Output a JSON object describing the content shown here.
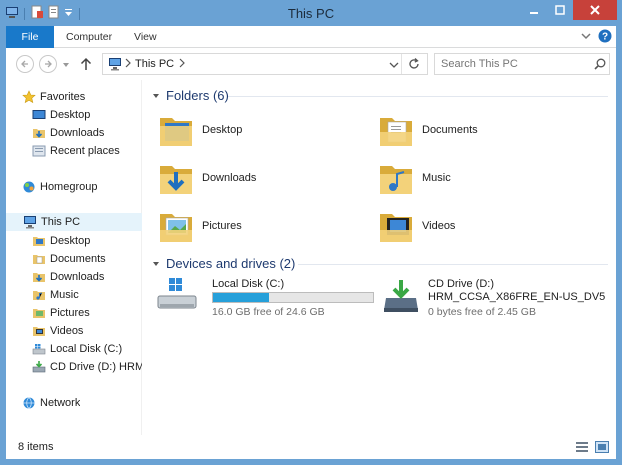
{
  "window": {
    "title": "This PC",
    "accent": "#6aa2d4",
    "close_color": "#c7413a"
  },
  "ribbon": {
    "tabs": [
      {
        "label": "File"
      },
      {
        "label": "Computer"
      },
      {
        "label": "View"
      }
    ]
  },
  "address": {
    "path": [
      "This PC"
    ],
    "search_placeholder": "Search This PC"
  },
  "nav": {
    "favorites": {
      "label": "Favorites",
      "items": [
        {
          "label": "Desktop",
          "icon": "desktop-icon"
        },
        {
          "label": "Downloads",
          "icon": "downloads-folder-icon"
        },
        {
          "label": "Recent places",
          "icon": "recent-places-icon"
        }
      ]
    },
    "homegroup": {
      "label": "Homegroup"
    },
    "thispc": {
      "label": "This PC",
      "items": [
        {
          "label": "Desktop",
          "icon": "folder-icon"
        },
        {
          "label": "Documents",
          "icon": "folder-icon"
        },
        {
          "label": "Downloads",
          "icon": "folder-icon"
        },
        {
          "label": "Music",
          "icon": "folder-icon"
        },
        {
          "label": "Pictures",
          "icon": "folder-icon"
        },
        {
          "label": "Videos",
          "icon": "folder-icon"
        },
        {
          "label": "Local Disk (C:)",
          "icon": "local-disk-icon"
        },
        {
          "label": "CD Drive (D:) HRM_C",
          "icon": "cd-drive-icon"
        }
      ]
    },
    "network": {
      "label": "Network"
    }
  },
  "folders": {
    "heading": "Folders (6)",
    "items": [
      {
        "label": "Desktop",
        "icon": "desktop-folder-icon"
      },
      {
        "label": "Documents",
        "icon": "documents-folder-icon"
      },
      {
        "label": "Downloads",
        "icon": "downloads-folder-icon"
      },
      {
        "label": "Music",
        "icon": "music-folder-icon"
      },
      {
        "label": "Pictures",
        "icon": "pictures-folder-icon"
      },
      {
        "label": "Videos",
        "icon": "videos-folder-icon"
      }
    ]
  },
  "drives": {
    "heading": "Devices and drives (2)",
    "items": [
      {
        "name": "Local Disk (C:)",
        "free_text": "16.0 GB free of 24.6 GB",
        "used_fraction": 0.35,
        "icon": "local-disk-icon"
      },
      {
        "name": "CD Drive (D:)",
        "label2": "HRM_CCSA_X86FRE_EN-US_DV5",
        "free_text": "0 bytes free of 2.45 GB",
        "icon": "cd-drive-icon"
      }
    ]
  },
  "status": {
    "count": "8 items"
  }
}
